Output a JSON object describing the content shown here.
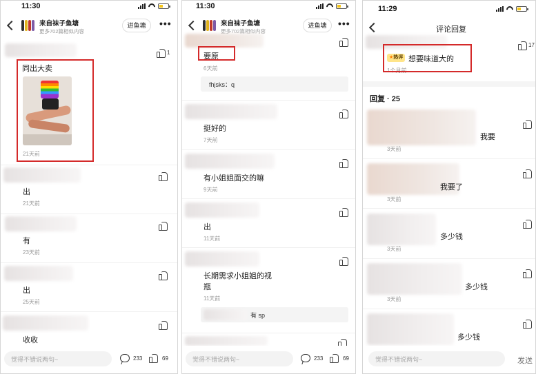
{
  "panels": [
    {
      "status": {
        "time": "11:30"
      },
      "header": {
        "title": "来自袜子鱼塘",
        "subtitle": "更多702篇相似内容",
        "join_label": "进鱼塘",
        "more_label": "•••"
      },
      "comments": [
        {
          "text": "同出大卖",
          "time": "21天前",
          "likes": "1"
        },
        {
          "text": "出",
          "time": "21天前"
        },
        {
          "text": "有",
          "time": "23天前"
        },
        {
          "text": "出",
          "time": "25天前"
        },
        {
          "text": "收收"
        }
      ],
      "bottom": {
        "placeholder": "觉得不错说两句~",
        "comments": "233",
        "likes": "69"
      }
    },
    {
      "status": {
        "time": "11:30"
      },
      "header": {
        "title": "来自袜子鱼塘",
        "subtitle": "更多702篇相似内容",
        "join_label": "进鱼塘",
        "more_label": "•••"
      },
      "comments": [
        {
          "text": "要原",
          "time": "6天前",
          "reply": "fhjsks：q"
        },
        {
          "text": "挺好的",
          "time": "7天前"
        },
        {
          "text": "有小姐姐面交的嘛",
          "time": "9天前"
        },
        {
          "text": "出",
          "time": "11天前"
        },
        {
          "text_line1": "长期需求小姐姐的视",
          "text_line2": "瓶",
          "time": "11天前",
          "reply": "有 sp"
        }
      ],
      "bottom": {
        "placeholder": "觉得不错说两句~",
        "comments": "233",
        "likes": "69"
      }
    },
    {
      "status": {
        "time": "11:29"
      },
      "header": {
        "title": "评论回复"
      },
      "main_comment": {
        "badge": "热评",
        "text": "想要味道大的",
        "time": "1个月前",
        "likes": "17"
      },
      "replies_header": "回复 · 25",
      "replies": [
        {
          "text": "我要",
          "time": "3天前"
        },
        {
          "text": "我要了",
          "time": "3天前"
        },
        {
          "text": "多少钱",
          "time": "3天前"
        },
        {
          "text": "多少钱",
          "time": "3天前"
        },
        {
          "text": "多少钱"
        }
      ],
      "bottom": {
        "placeholder": "觉得不错说两句~",
        "send_label": "发送"
      }
    }
  ]
}
